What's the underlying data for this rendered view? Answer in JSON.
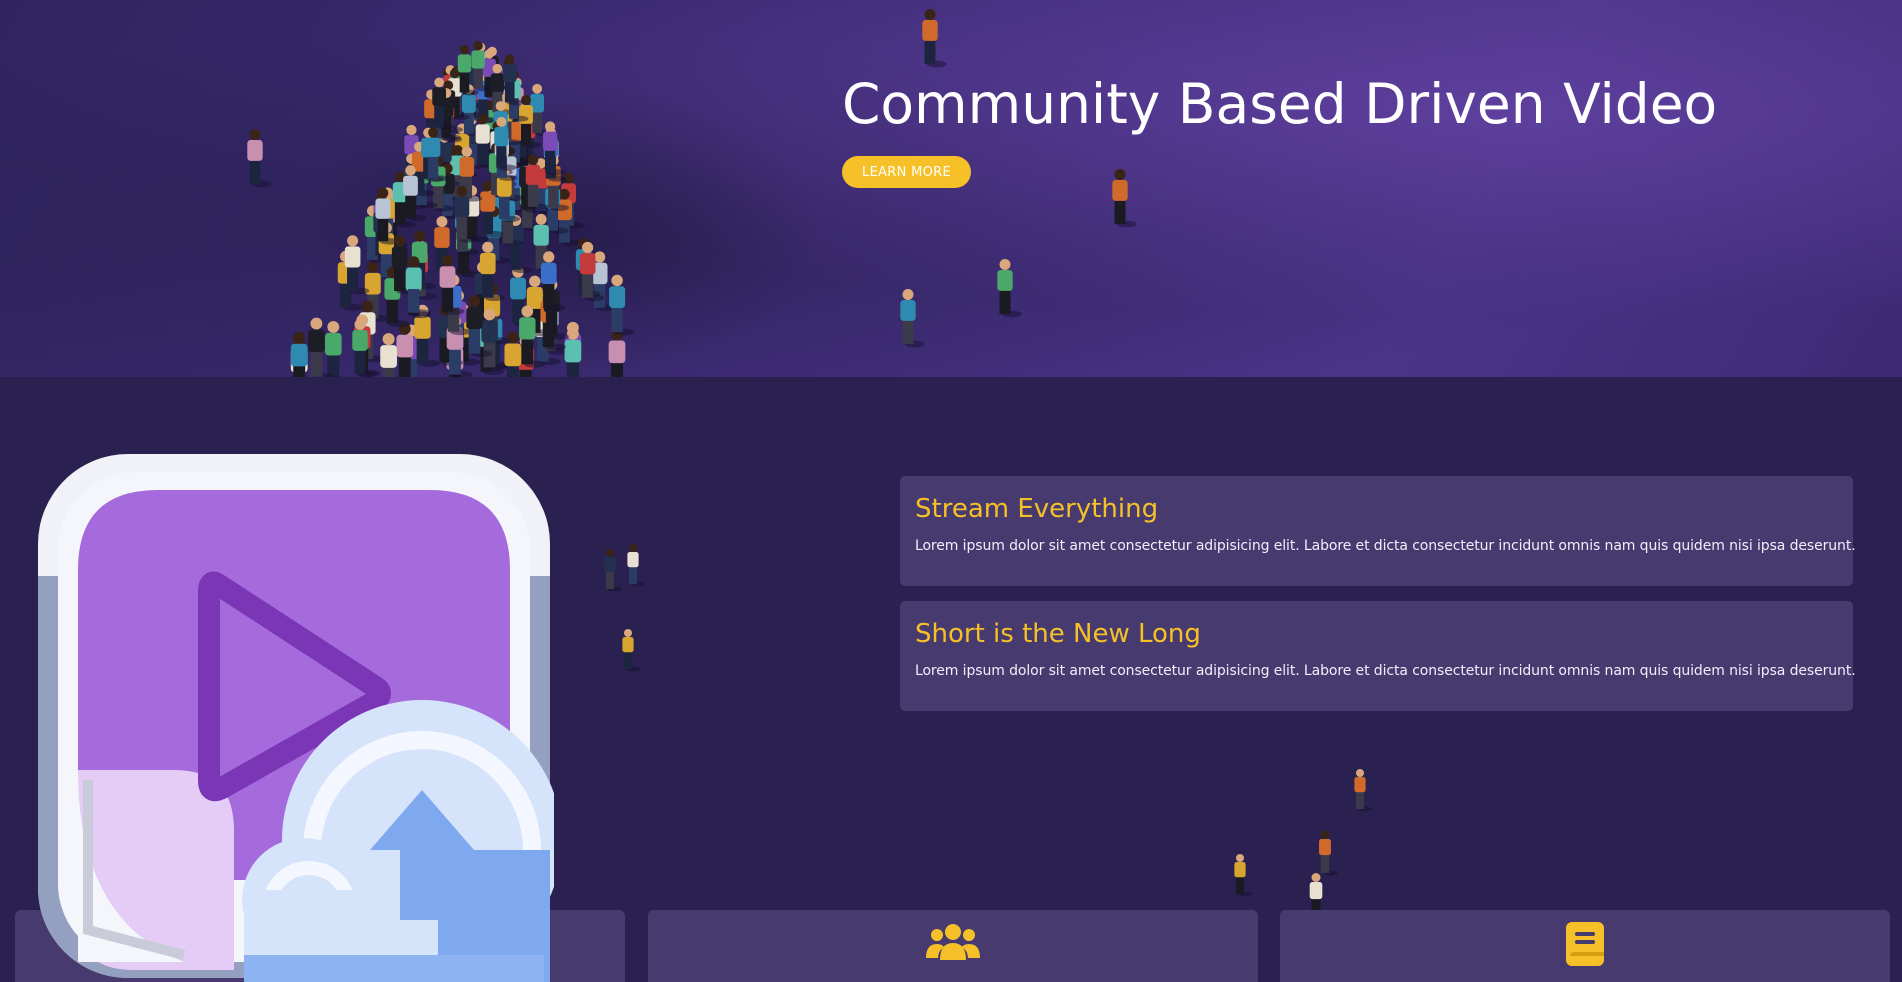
{
  "hero": {
    "title": "Community Based Driven Video",
    "cta_label": "LEARN MORE"
  },
  "features": [
    {
      "title": "Stream Everything",
      "text": "Lorem ipsum dolor sit amet consectetur adipisicing elit. Labore et dicta consectetur incidunt omnis nam quis quidem nisi ipsa deserunt."
    },
    {
      "title": "Short is the New Long",
      "text": "Lorem ipsum dolor sit amet consectetur adipisicing elit. Labore et dicta consectetur incidunt omnis nam quis quidem nisi ipsa deserunt."
    }
  ],
  "bottom_cards": [
    {
      "icon": "video-camera-icon"
    },
    {
      "icon": "users-icon"
    },
    {
      "icon": "book-icon"
    }
  ],
  "colors": {
    "accent": "#f6c128",
    "background": "#2b2150",
    "card": "#463a6e",
    "hero": "#3f2d78"
  },
  "overlay_icon": "video-upload-app-icon"
}
